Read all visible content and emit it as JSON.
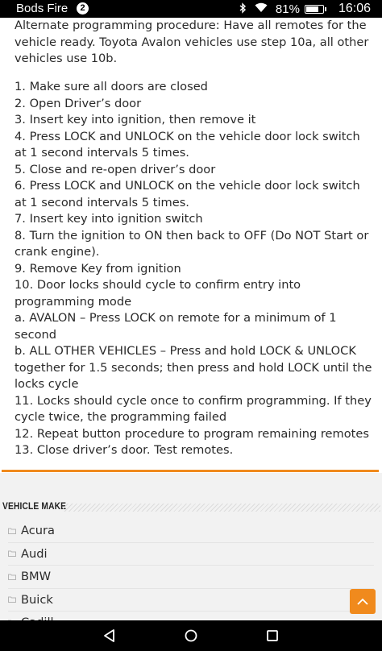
{
  "status_bar": {
    "app_name": "Bods Fire",
    "notification_count": "2",
    "battery_percent": "81%",
    "battery_level": 0.81,
    "time": "16:06",
    "icons": [
      "bluetooth-icon",
      "wifi-icon",
      "battery-icon"
    ]
  },
  "article": {
    "intro": "Alternate programming procedure: Have all remotes for the vehicle ready. Toyota Avalon vehicles use step 10a, all other vehicles use 10b.",
    "steps": [
      "1. Make sure all doors are closed",
      "2. Open Driver’s door",
      "3. Insert key into ignition, then remove it",
      "4. Press LOCK and UNLOCK on the vehicle door lock switch at 1 second intervals 5 times.",
      "5. Close and re-open driver’s door",
      "6. Press LOCK and UNLOCK on the vehicle door lock switch at 1 second intervals 5 times.",
      "7. Insert key into ignition switch",
      "8. Turn the ignition to ON then back to OFF (Do NOT Start or crank engine).",
      "9. Remove Key from ignition",
      "10. Door locks should cycle to confirm entry into programming mode",
      "a. AVALON – Press LOCK on remote for a minimum of 1 second",
      "b. ALL OTHER VEHICLES – Press and hold LOCK & UNLOCK together for 1.5 seconds; then press and hold LOCK until the locks cycle",
      "11. Locks should cycle once to confirm programming. If they cycle twice, the programming failed",
      "12. Repeat button procedure to program remaining remotes",
      "13. Close driver’s door. Test remotes."
    ]
  },
  "sidebar_widget": {
    "title": "VEHICLE MAKE",
    "makes": [
      "Acura",
      "Audi",
      "BMW",
      "Buick",
      "Cadill"
    ]
  },
  "colors": {
    "accent": "#f08a1d",
    "text": "#2a2a2a",
    "background": "#ffffff"
  },
  "nav_bar": {
    "icons": [
      "back-icon",
      "home-icon",
      "recent-apps-icon"
    ]
  }
}
